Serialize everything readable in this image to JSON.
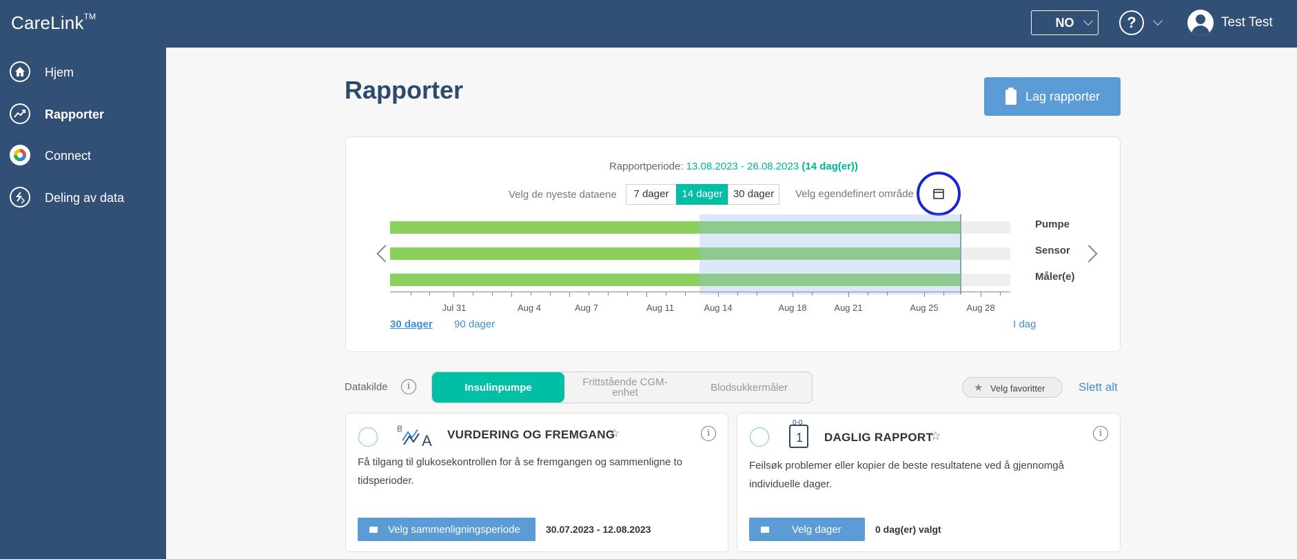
{
  "app": {
    "logo": "CareLink",
    "logo_tm": "TM"
  },
  "header": {
    "language": "NO",
    "user_name": "Test Test"
  },
  "sidebar": {
    "items": [
      {
        "label": "Hjem",
        "icon": "home-icon"
      },
      {
        "label": "Rapporter",
        "icon": "trend-icon",
        "active": true
      },
      {
        "label": "Connect",
        "icon": "connect-icon"
      },
      {
        "label": "Deling av data",
        "icon": "share-icon"
      }
    ]
  },
  "page": {
    "title": "Rapporter",
    "create_button": "Lag rapporter"
  },
  "period": {
    "label": "Rapportperiode:",
    "dates": "13.08.2023 - 26.08.2023",
    "count": "(14 dag(er))",
    "newest_label": "Velg de nyeste dataene",
    "day_options": [
      "7 dager",
      "14 dager",
      "30 dager"
    ],
    "selected_option": "14 dager",
    "custom_label": "Velg egendefinert område",
    "rows": [
      "Pumpe",
      "Sensor",
      "Måler(e)"
    ],
    "ticks": [
      "Jul 31",
      "Aug 4",
      "Aug 7",
      "Aug 11",
      "Aug 14",
      "Aug 18",
      "Aug 21",
      "Aug 25",
      "Aug 28"
    ],
    "range_links": [
      "30 dager",
      "90 dager"
    ],
    "today_link": "I dag"
  },
  "datasource": {
    "label": "Datakilde",
    "tabs": [
      "Insulinpumpe",
      "Frittstående CGM-enhet",
      "Blodsukkermåler"
    ],
    "selected": "Insulinpumpe",
    "favorites_button": "Velg favoritter",
    "clear_all": "Slett alt"
  },
  "cards": [
    {
      "title": "VURDERING OG FREMGANG",
      "icon": "assessment-icon",
      "icon_letters": [
        "B",
        "A"
      ],
      "description": "Få tilgang til glukosekontrollen for å se fremgangen og sammenligne to tidsperioder.",
      "action": "Velg sammenligningsperiode",
      "meta": "30.07.2023 - 12.08.2023"
    },
    {
      "title": "DAGLIG RAPPORT",
      "icon": "calendar-day-icon",
      "icon_digits": [
        "0-0",
        "1"
      ],
      "description": "Feilsøk problemer eller kopier de beste resultatene ved å gjennomgå individuelle dager.",
      "action": "Velg dager",
      "meta": "0 dag(er) valgt"
    }
  ]
}
